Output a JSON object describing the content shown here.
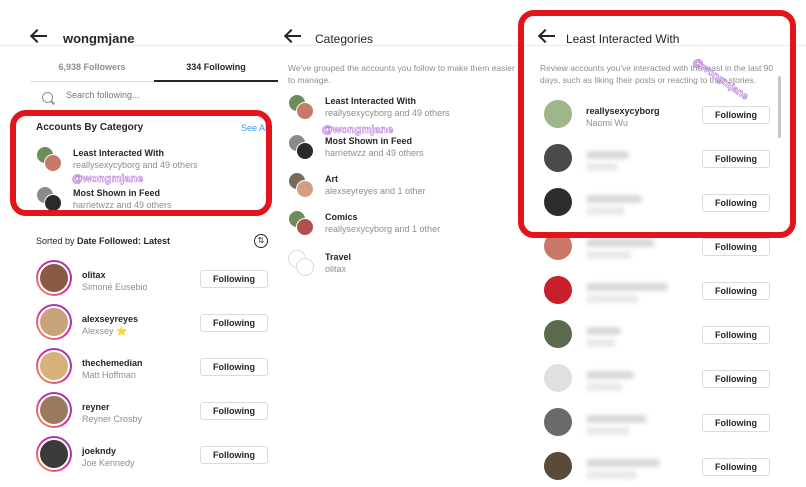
{
  "following_panel": {
    "username": "wongmjane",
    "tabs": [
      {
        "label": "6,938 Followers",
        "active": false
      },
      {
        "label": "334 Following",
        "active": true
      }
    ],
    "search_placeholder": "Search following...",
    "categories_title": "Accounts By Category",
    "see_all": "See All",
    "categories": [
      {
        "name": "Least Interacted With",
        "sub": "reallysexycyborg and 49 others"
      },
      {
        "name": "Most Shown in Feed",
        "sub": "harrietwzz and 49 others"
      }
    ],
    "watermark": "@wongmjane",
    "sort_prefix": "Sorted by ",
    "sort_value": "Date Followed: Latest",
    "users": [
      {
        "username": "olitax",
        "name": "Simoné Eusebio",
        "button": "Following",
        "color": "#8a5a44"
      },
      {
        "username": "alexseyreyes",
        "name": "Alexsey ⭐",
        "button": "Following",
        "color": "#c9a27a"
      },
      {
        "username": "thechemedian",
        "name": "Matt Hoffman",
        "button": "Following",
        "color": "#d8b07a"
      },
      {
        "username": "reyner",
        "name": "Reyner Crosby",
        "button": "Following",
        "color": "#9a7a5e"
      },
      {
        "username": "joekndy",
        "name": "Joe Kennedy",
        "button": "Following",
        "color": "#3a3a3a"
      }
    ]
  },
  "categories_panel": {
    "title": "Categories",
    "description": "We've grouped the accounts you follow to make them easier to manage.",
    "items": [
      {
        "name": "Least Interacted With",
        "sub": "reallysexycyborg and 49 others"
      },
      {
        "name": "Most Shown in Feed",
        "sub": "harrietwzz and 49 others"
      },
      {
        "name": "Art",
        "sub": "alexseyreyes and 1 other"
      },
      {
        "name": "Comics",
        "sub": "reallysexycyborg and 1 other"
      },
      {
        "name": "Travel",
        "sub": "olitax"
      }
    ],
    "watermark": "@wongmjane"
  },
  "least_panel": {
    "title": "Least Interacted With",
    "description": "Review accounts you've interacted with the least in the last 90 days, such as liking their posts or reacting to their stories.",
    "watermark": "@wongmjane",
    "users": [
      {
        "username": "reallysexycyborg",
        "name": "Naomi Wu",
        "button": "Following",
        "color": "#9fb58a"
      },
      {
        "username": "",
        "name": "",
        "button": "Following",
        "color": "#4a4a4a"
      },
      {
        "username": "",
        "name": "",
        "button": "Following",
        "color": "#2d2d2d"
      },
      {
        "username": "",
        "name": "",
        "button": "Following",
        "color": "#c87866"
      },
      {
        "username": "",
        "name": "",
        "button": "Following",
        "color": "#c8202a"
      },
      {
        "username": "",
        "name": "",
        "button": "Following",
        "color": "#5a6a4a"
      },
      {
        "username": "",
        "name": "",
        "button": "Following",
        "color": "#e0e0e0"
      },
      {
        "username": "",
        "name": "",
        "button": "Following",
        "color": "#6a6a6a"
      },
      {
        "username": "",
        "name": "",
        "button": "Following",
        "color": "#5a4a3a"
      }
    ]
  },
  "colors": {
    "highlight": "#e2141c",
    "link": "#3897f0",
    "muted": "#8e8e8e"
  }
}
